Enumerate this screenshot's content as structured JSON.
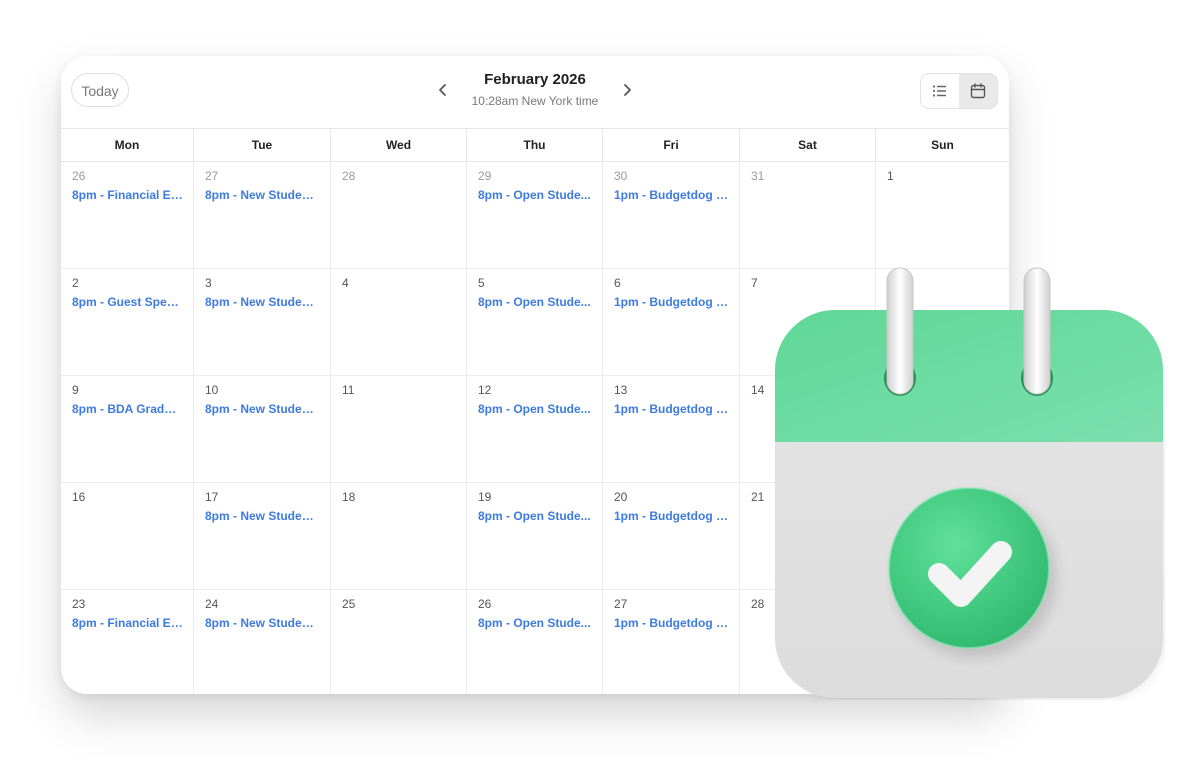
{
  "header": {
    "today_label": "Today",
    "month_title": "February 2026",
    "timezone": "10:28am New York time",
    "prev_icon": "chevron-left-icon",
    "next_icon": "chevron-right-icon",
    "view_list_icon": "list-icon",
    "view_calendar_icon": "calendar-icon",
    "active_view": "calendar"
  },
  "weekdays": [
    "Mon",
    "Tue",
    "Wed",
    "Thu",
    "Fri",
    "Sat",
    "Sun"
  ],
  "weeks": [
    [
      {
        "day": "26",
        "muted": true,
        "event": "8pm - Financial Ed..."
      },
      {
        "day": "27",
        "muted": true,
        "event": "8pm - New Student..."
      },
      {
        "day": "28",
        "muted": true,
        "event": ""
      },
      {
        "day": "29",
        "muted": true,
        "event": "8pm - Open Stude..."
      },
      {
        "day": "30",
        "muted": true,
        "event": "1pm - Budgetdog T..."
      },
      {
        "day": "31",
        "muted": true,
        "event": ""
      },
      {
        "day": "1",
        "muted": false,
        "event": ""
      }
    ],
    [
      {
        "day": "2",
        "muted": false,
        "event": "8pm - Guest Speak..."
      },
      {
        "day": "3",
        "muted": false,
        "event": "8pm - New Student..."
      },
      {
        "day": "4",
        "muted": false,
        "event": ""
      },
      {
        "day": "5",
        "muted": false,
        "event": "8pm - Open Stude..."
      },
      {
        "day": "6",
        "muted": false,
        "event": "1pm - Budgetdog T..."
      },
      {
        "day": "7",
        "muted": false,
        "event": ""
      },
      {
        "day": "",
        "muted": false,
        "event": ""
      }
    ],
    [
      {
        "day": "9",
        "muted": false,
        "event": "8pm - BDA Gradua..."
      },
      {
        "day": "10",
        "muted": false,
        "event": "8pm - New Student..."
      },
      {
        "day": "11",
        "muted": false,
        "event": ""
      },
      {
        "day": "12",
        "muted": false,
        "event": "8pm - Open Stude..."
      },
      {
        "day": "13",
        "muted": false,
        "event": "1pm - Budgetdog T..."
      },
      {
        "day": "14",
        "muted": false,
        "event": ""
      },
      {
        "day": "",
        "muted": false,
        "event": ""
      }
    ],
    [
      {
        "day": "16",
        "muted": false,
        "event": ""
      },
      {
        "day": "17",
        "muted": false,
        "event": "8pm - New Student..."
      },
      {
        "day": "18",
        "muted": false,
        "event": ""
      },
      {
        "day": "19",
        "muted": false,
        "event": "8pm - Open Stude..."
      },
      {
        "day": "20",
        "muted": false,
        "event": "1pm - Budgetdog T..."
      },
      {
        "day": "21",
        "muted": false,
        "event": ""
      },
      {
        "day": "",
        "muted": false,
        "event": ""
      }
    ],
    [
      {
        "day": "23",
        "muted": false,
        "event": "8pm - Financial Ed..."
      },
      {
        "day": "24",
        "muted": false,
        "event": "8pm - New Student..."
      },
      {
        "day": "25",
        "muted": false,
        "event": ""
      },
      {
        "day": "26",
        "muted": false,
        "event": "8pm - Open Stude..."
      },
      {
        "day": "27",
        "muted": false,
        "event": "1pm - Budgetdog T..."
      },
      {
        "day": "28",
        "muted": false,
        "event": ""
      },
      {
        "day": "",
        "muted": false,
        "event": ""
      }
    ]
  ],
  "illustration": {
    "icon": "calendar-check-icon",
    "accent_color": "#4fcf8a",
    "event_color": "#3d7be0"
  }
}
